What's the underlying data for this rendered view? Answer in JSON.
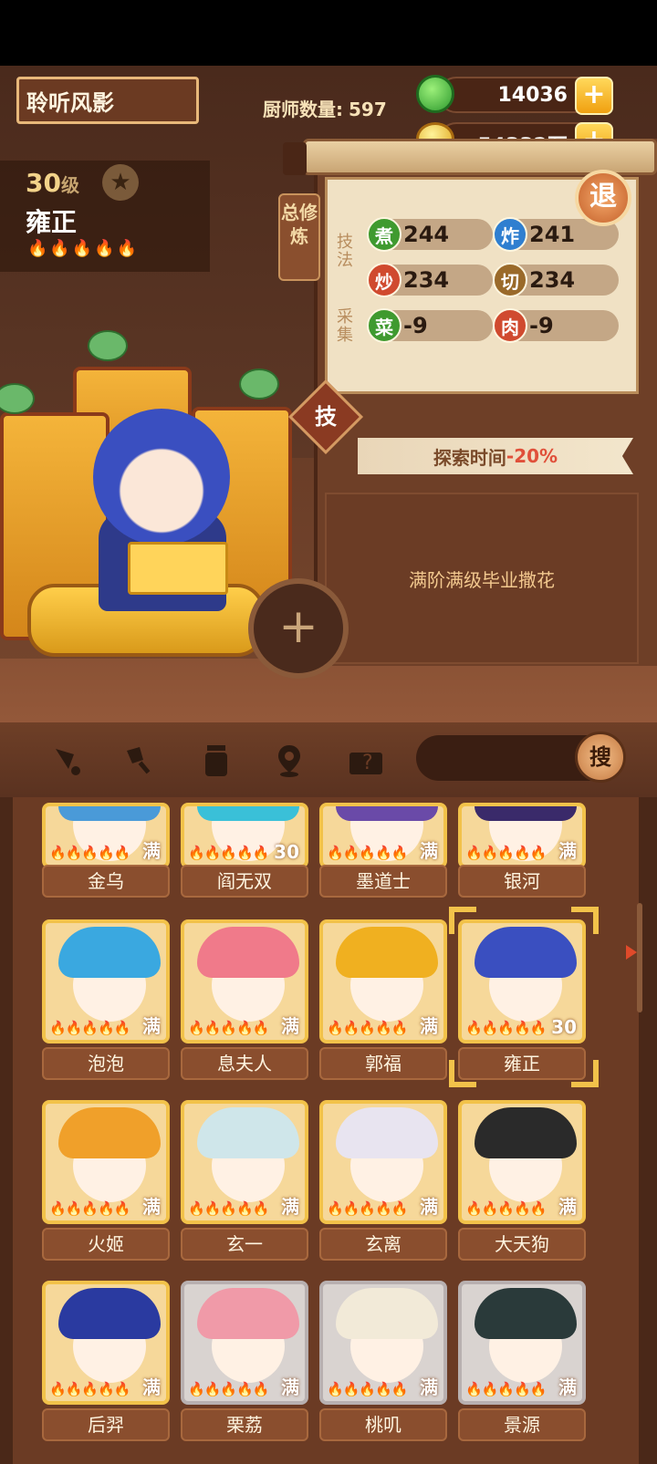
{
  "header": {
    "player_name": "聆听风影",
    "chef_count_label": "厨师数量:",
    "chef_count": "597"
  },
  "resources": {
    "jade": "14036",
    "coins": "54332万",
    "plus": "+"
  },
  "chef": {
    "level": "30",
    "level_unit": "级",
    "name": "雍正",
    "star": "★",
    "flames": "🔥🔥🔥🔥🔥"
  },
  "training": {
    "tab_label": "总修炼",
    "skill_label": "技法",
    "gather_label": "采集",
    "exit_label": "退",
    "stats": [
      {
        "icon": "煮",
        "value": "244",
        "color": "#3f9a2f"
      },
      {
        "icon": "炸",
        "value": "241",
        "color": "#2f7fd0"
      },
      {
        "icon": "炒",
        "value": "234",
        "color": "#d04a2f"
      },
      {
        "icon": "切",
        "value": "234",
        "color": "#9a6a2a"
      },
      {
        "icon": "菜",
        "value": "-9",
        "color": "#3f9a2f"
      },
      {
        "icon": "肉",
        "value": "-9",
        "color": "#d04a2f"
      }
    ]
  },
  "skill": {
    "button_label": "技",
    "explore_prefix": "探索时间",
    "explore_value": "-20%",
    "comment": "满阶满级毕业撒花",
    "add_label": "+"
  },
  "toolbar": {
    "search_label": "搜"
  },
  "chefs": [
    {
      "name": "金乌",
      "badge": "满",
      "hair": "#4a9ad8"
    },
    {
      "name": "阎无双",
      "badge": "30",
      "hair": "#3ac0d8"
    },
    {
      "name": "墨道士",
      "badge": "满",
      "hair": "#6a4aa8"
    },
    {
      "name": "银河",
      "badge": "满",
      "hair": "#3a2a6a"
    },
    {
      "name": "泡泡",
      "badge": "满",
      "hair": "#3aa8e0"
    },
    {
      "name": "息夫人",
      "badge": "满",
      "hair": "#f07a8a"
    },
    {
      "name": "郭福",
      "badge": "满",
      "hair": "#f0b020"
    },
    {
      "name": "雍正",
      "badge": "30",
      "hair": "#3a4fc0"
    },
    {
      "name": "火姬",
      "badge": "满",
      "hair": "#f0a02a"
    },
    {
      "name": "玄一",
      "badge": "满",
      "hair": "#cfe6ea"
    },
    {
      "name": "玄离",
      "badge": "满",
      "hair": "#e8e4f0"
    },
    {
      "name": "大天狗",
      "badge": "满",
      "hair": "#2a2a2a"
    },
    {
      "name": "后羿",
      "badge": "满",
      "hair": "#2a3aa0"
    },
    {
      "name": "栗荔",
      "badge": "满",
      "hair": "#f09aa8"
    },
    {
      "name": "桃叽",
      "badge": "满",
      "hair": "#f2ead8"
    },
    {
      "name": "景源",
      "badge": "满",
      "hair": "#2a3a3a"
    }
  ],
  "card_flames": "🔥🔥🔥🔥🔥"
}
